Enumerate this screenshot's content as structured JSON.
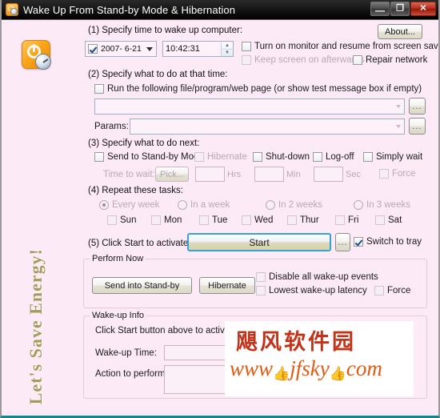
{
  "window": {
    "title": "Wake Up From Stand-by Mode & Hibernation",
    "icon": "power-clock-icon",
    "minimize_glyph": "—",
    "maximize_glyph": "❐",
    "close_glyph": "✕"
  },
  "rail": {
    "app_icon": "power-timer-icon",
    "slogan": "Let's Save Energy!"
  },
  "about_button": "About...",
  "steps": {
    "step1_label": "(1) Specify time to wake up computer:",
    "step2_label": "(2) Specify what to do at that time:",
    "step3_label": "(3) Specify what to do next:",
    "step4_label": "(4) Repeat these tasks:",
    "step5_label": "(5) Click Start to activate:"
  },
  "step1": {
    "date_value": "2007- 6-21",
    "date_enabled": true,
    "time_value": "10:42:31",
    "turn_on_monitor": "Turn on monitor and resume from screen saver",
    "turn_on_monitor_checked": false,
    "keep_screen_on": "Keep screen on afterwards",
    "keep_screen_on_checked": false,
    "keep_screen_on_disabled": true,
    "repair_network": "Repair network",
    "repair_network_checked": false
  },
  "step2": {
    "run_file_label": "Run the following file/program/web page (or show test message box if empty)",
    "run_file_checked": false,
    "file_value": "",
    "file_placeholder": "",
    "params_label": "Params:",
    "params_value": "",
    "browse_button": "...",
    "params_browse_button": "..."
  },
  "step3": {
    "options": [
      {
        "label": "Send to Stand-by Mode",
        "checked": false,
        "disabled": false
      },
      {
        "label": "Hibernate",
        "checked": false,
        "disabled": true
      },
      {
        "label": "Shut-down",
        "checked": false,
        "disabled": false
      },
      {
        "label": "Log-off",
        "checked": false,
        "disabled": false
      },
      {
        "label": "Simply wait",
        "checked": false,
        "disabled": false
      }
    ],
    "time_to_wait_label": "Time to wait:",
    "pick_button": "Pick...",
    "hrs_value": "",
    "hrs_unit": "Hrs",
    "min_value": "",
    "min_unit": "Min",
    "sec_value": "",
    "sec_unit": "Sec",
    "force_label": "Force",
    "force_checked": false
  },
  "step4": {
    "radios": [
      {
        "label": "Every week",
        "selected": true
      },
      {
        "label": "In a week",
        "selected": false
      },
      {
        "label": "In 2 weeks",
        "selected": false
      },
      {
        "label": "In 3 weeks",
        "selected": false
      }
    ],
    "days": [
      {
        "label": "Sun",
        "checked": false
      },
      {
        "label": "Mon",
        "checked": false
      },
      {
        "label": "Tue",
        "checked": false
      },
      {
        "label": "Wed",
        "checked": false
      },
      {
        "label": "Thur",
        "checked": false
      },
      {
        "label": "Fri",
        "checked": false
      },
      {
        "label": "Sat",
        "checked": false
      }
    ]
  },
  "step5": {
    "start_button": "Start",
    "options_button": "...",
    "switch_to_tray": "Switch to tray",
    "switch_to_tray_checked": true
  },
  "perform_now": {
    "legend": "Perform Now",
    "standby_button": "Send into Stand-by",
    "hibernate_button": "Hibernate",
    "disable_all_label": "Disable all wake-up events",
    "disable_all_checked": false,
    "lowest_latency_label": "Lowest wake-up latency",
    "lowest_latency_checked": false,
    "force_label": "Force",
    "force_checked": false
  },
  "wakeup_info": {
    "legend": "Wake-up Info",
    "hint": "Click Start button above to activate",
    "wakeup_time_label": "Wake-up Time:",
    "wakeup_time_value": "",
    "action_label": "Action to perform:",
    "action_value": "",
    "scroll_up_glyph": "▲",
    "scroll_down_glyph": "▼"
  },
  "watermark": {
    "chinese": "飓风软件园",
    "url_part1": "www",
    "url_part2": "jfsky",
    "url_part3": "com",
    "thumb_glyph": "👍"
  },
  "colors": {
    "window_background": "#fdeaf7",
    "titlebar": "#000000",
    "close_button": "#b4291a",
    "accent_focus": "#3aa0d8",
    "slogan": "#a89a5e",
    "watermark_red": "#c3331a",
    "watermark_orange": "#e05a12",
    "bottom_border": "#0a8a8f"
  }
}
